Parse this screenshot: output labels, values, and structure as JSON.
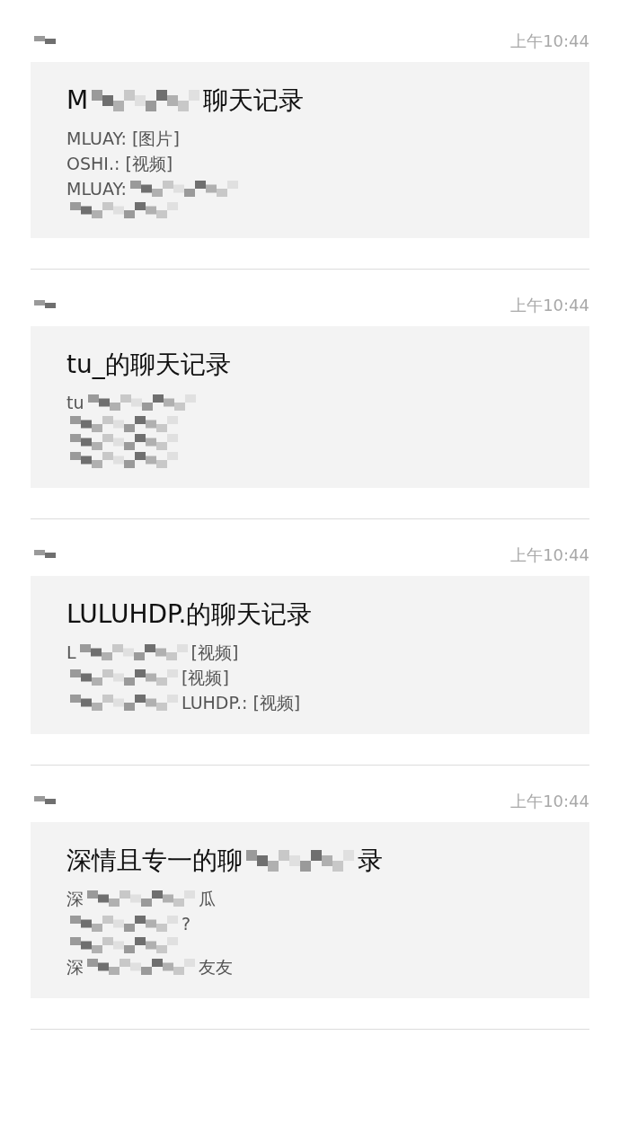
{
  "messages": [
    {
      "time": "上午10:44",
      "title": [
        {
          "kind": "text",
          "text": "M"
        },
        {
          "kind": "mosaic"
        },
        {
          "kind": "text",
          "text": "聊天记录"
        }
      ],
      "lines": [
        [
          {
            "kind": "text",
            "text": "MLUAY: [图片]"
          }
        ],
        [
          {
            "kind": "text",
            "text": "OSHI.: [视频]"
          }
        ],
        [
          {
            "kind": "text",
            "text": "MLUAY:"
          },
          {
            "kind": "mosaic"
          }
        ],
        [
          {
            "kind": "mosaic"
          }
        ]
      ]
    },
    {
      "time": "上午10:44",
      "title": [
        {
          "kind": "text",
          "text": "tu_的聊天记录"
        }
      ],
      "lines": [
        [
          {
            "kind": "text",
            "text": "tu"
          },
          {
            "kind": "mosaic"
          }
        ],
        [
          {
            "kind": "mosaic"
          }
        ],
        [
          {
            "kind": "mosaic"
          }
        ],
        [
          {
            "kind": "mosaic"
          }
        ]
      ]
    },
    {
      "time": "上午10:44",
      "title": [
        {
          "kind": "text",
          "text": "LULUHDP.的聊天记录"
        }
      ],
      "lines": [
        [
          {
            "kind": "text",
            "text": "L"
          },
          {
            "kind": "mosaic"
          },
          {
            "kind": "text",
            "text": "[视频]"
          }
        ],
        [
          {
            "kind": "mosaic"
          },
          {
            "kind": "text",
            "text": "[视频]"
          }
        ],
        [
          {
            "kind": "mosaic"
          },
          {
            "kind": "text",
            "text": "LUHDP.: [视频]"
          }
        ]
      ]
    },
    {
      "time": "上午10:44",
      "title": [
        {
          "kind": "text",
          "text": "深情且专一的聊"
        },
        {
          "kind": "mosaic"
        },
        {
          "kind": "text",
          "text": "录"
        }
      ],
      "lines": [
        [
          {
            "kind": "text",
            "text": "深"
          },
          {
            "kind": "mosaic"
          },
          {
            "kind": "text",
            "text": "瓜"
          }
        ],
        [
          {
            "kind": "mosaic"
          },
          {
            "kind": "text",
            "text": "?"
          }
        ],
        [
          {
            "kind": "mosaic"
          }
        ],
        [
          {
            "kind": "text",
            "text": "深"
          },
          {
            "kind": "mosaic"
          },
          {
            "kind": "text",
            "text": "友友"
          }
        ]
      ]
    }
  ]
}
